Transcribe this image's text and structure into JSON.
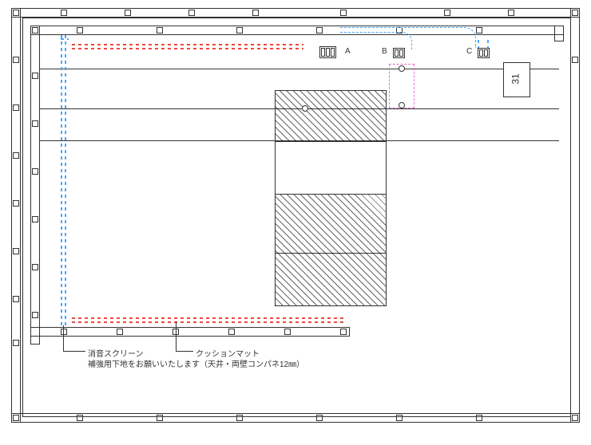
{
  "labels": {
    "A": "A",
    "B": "B",
    "C": "C"
  },
  "room_number": "31",
  "notes": {
    "screen": "消音スクリーン",
    "mat": "クッションマット",
    "reinforce": "補強用下地をお願いいたします（天井・両壁コンパネ12㎜）"
  },
  "chart_data": {
    "type": "diagram",
    "description": "Architectural floor plan / interior elevation showing a room with wall framing, a hatched rectangular element (door/panel), electrical outlet locations labeled A B C, a room tag 31, dashed blue lines indicating a sound-absorbing screen with reinforcement substrate, and dashed red lines indicating cushion mat extents.",
    "elements": {
      "outlet_A": {
        "gangs": 3,
        "pos": "upper area, left of center-right"
      },
      "outlet_B": {
        "gangs": 2,
        "pos": "upper area, right of A"
      },
      "outlet_C": {
        "gangs": 2,
        "pos": "upper area, far right"
      },
      "room_tag": {
        "value": "31",
        "pos": "upper-right, boxed"
      },
      "hatched_panel": {
        "shape": "rectangle split into upper/lower halves",
        "pos": "center"
      },
      "screen_lines": {
        "style": "dashed blue",
        "pos": "inside left wall, vertical; curved at top right to outlets"
      },
      "mat_lines": {
        "style": "dashed red",
        "pos": "near top interior and near interior floor, horizontal"
      },
      "wiring_pink": {
        "style": "dashed pink box with contacts",
        "pos": "right of hatched panel, with two contact points"
      }
    },
    "callouts": [
      {
        "target": "screen_lines",
        "text": "消音スクリーン"
      },
      {
        "target": "mat_lines",
        "text": "クッションマット"
      },
      {
        "text": "補強用下地をお願いいたします（天井・両壁コンパネ12㎜）"
      }
    ]
  }
}
